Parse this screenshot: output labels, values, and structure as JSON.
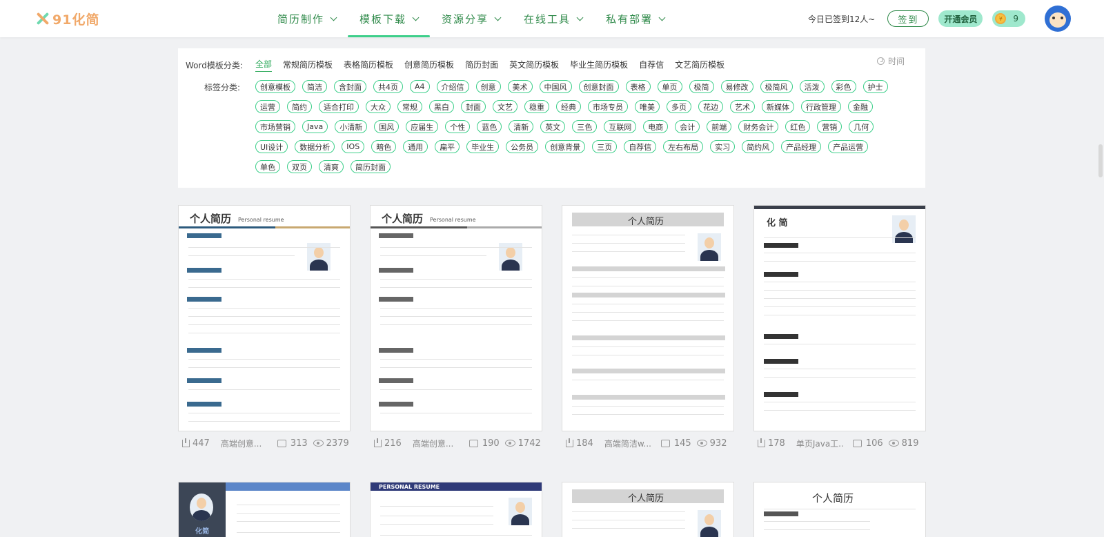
{
  "logo": {
    "text": "91化简"
  },
  "nav": [
    {
      "label": "简历制作"
    },
    {
      "label": "模板下载",
      "active": true
    },
    {
      "label": "资源分享"
    },
    {
      "label": "在线工具"
    },
    {
      "label": "私有部署"
    }
  ],
  "header": {
    "signin_text": "今日已签到12人~",
    "signin_button": "签到",
    "vip_button": "开通会员",
    "coin_count": "9"
  },
  "filter": {
    "sort_label": "时间",
    "category_label": "Word模板分类:",
    "categories": [
      "全部",
      "常规简历模板",
      "表格简历模板",
      "创意简历模板",
      "简历封面",
      "英文简历模板",
      "毕业生简历模板",
      "自荐信",
      "文艺简历模板"
    ],
    "tag_label": "标签分类:",
    "tags": [
      "创意模板",
      "简洁",
      "含封面",
      "共4页",
      "A4",
      "介绍信",
      "创意",
      "美术",
      "中国风",
      "创意封面",
      "表格",
      "单页",
      "极简",
      "易修改",
      "极简风",
      "活泼",
      "彩色",
      "护士",
      "运营",
      "简约",
      "适合打印",
      "大众",
      "常规",
      "黑白",
      "封面",
      "文艺",
      "稳重",
      "经典",
      "市场专员",
      "唯美",
      "多页",
      "花边",
      "艺术",
      "新媒体",
      "行政管理",
      "金融",
      "市场营销",
      "Java",
      "小清新",
      "国风",
      "应届生",
      "个性",
      "蓝色",
      "清新",
      "英文",
      "三色",
      "互联网",
      "电商",
      "会计",
      "前端",
      "财务会计",
      "红色",
      "营销",
      "几何",
      "UI设计",
      "数据分析",
      "IOS",
      "暗色",
      "通用",
      "扁平",
      "毕业生",
      "公务员",
      "创意背景",
      "三页",
      "自荐信",
      "左右布局",
      "实习",
      "简约风",
      "产品经理",
      "产品运营",
      "单色",
      "双页",
      "清爽",
      "简历封面"
    ]
  },
  "cards": [
    {
      "downloads": "447",
      "title": "高端创意...",
      "comments": "313",
      "views": "2379",
      "preview_title": "个人简历",
      "preview_sub": "Personal resume"
    },
    {
      "downloads": "216",
      "title": "高端创意...",
      "comments": "190",
      "views": "1742",
      "preview_title": "个人简历",
      "preview_sub": "Personal resume"
    },
    {
      "downloads": "184",
      "title": "高端简洁w...",
      "comments": "145",
      "views": "932",
      "preview_title": "个人简历",
      "preview_sub": ""
    },
    {
      "downloads": "178",
      "title": "单页Java工...",
      "comments": "106",
      "views": "819",
      "preview_title": "化 简",
      "preview_sub": ""
    }
  ],
  "cards_row2": [
    {
      "preview_title": "化简"
    },
    {
      "preview_title": "PERSONAL RESUME"
    },
    {
      "preview_title": "个人简历"
    },
    {
      "preview_title": "个人简历"
    }
  ]
}
